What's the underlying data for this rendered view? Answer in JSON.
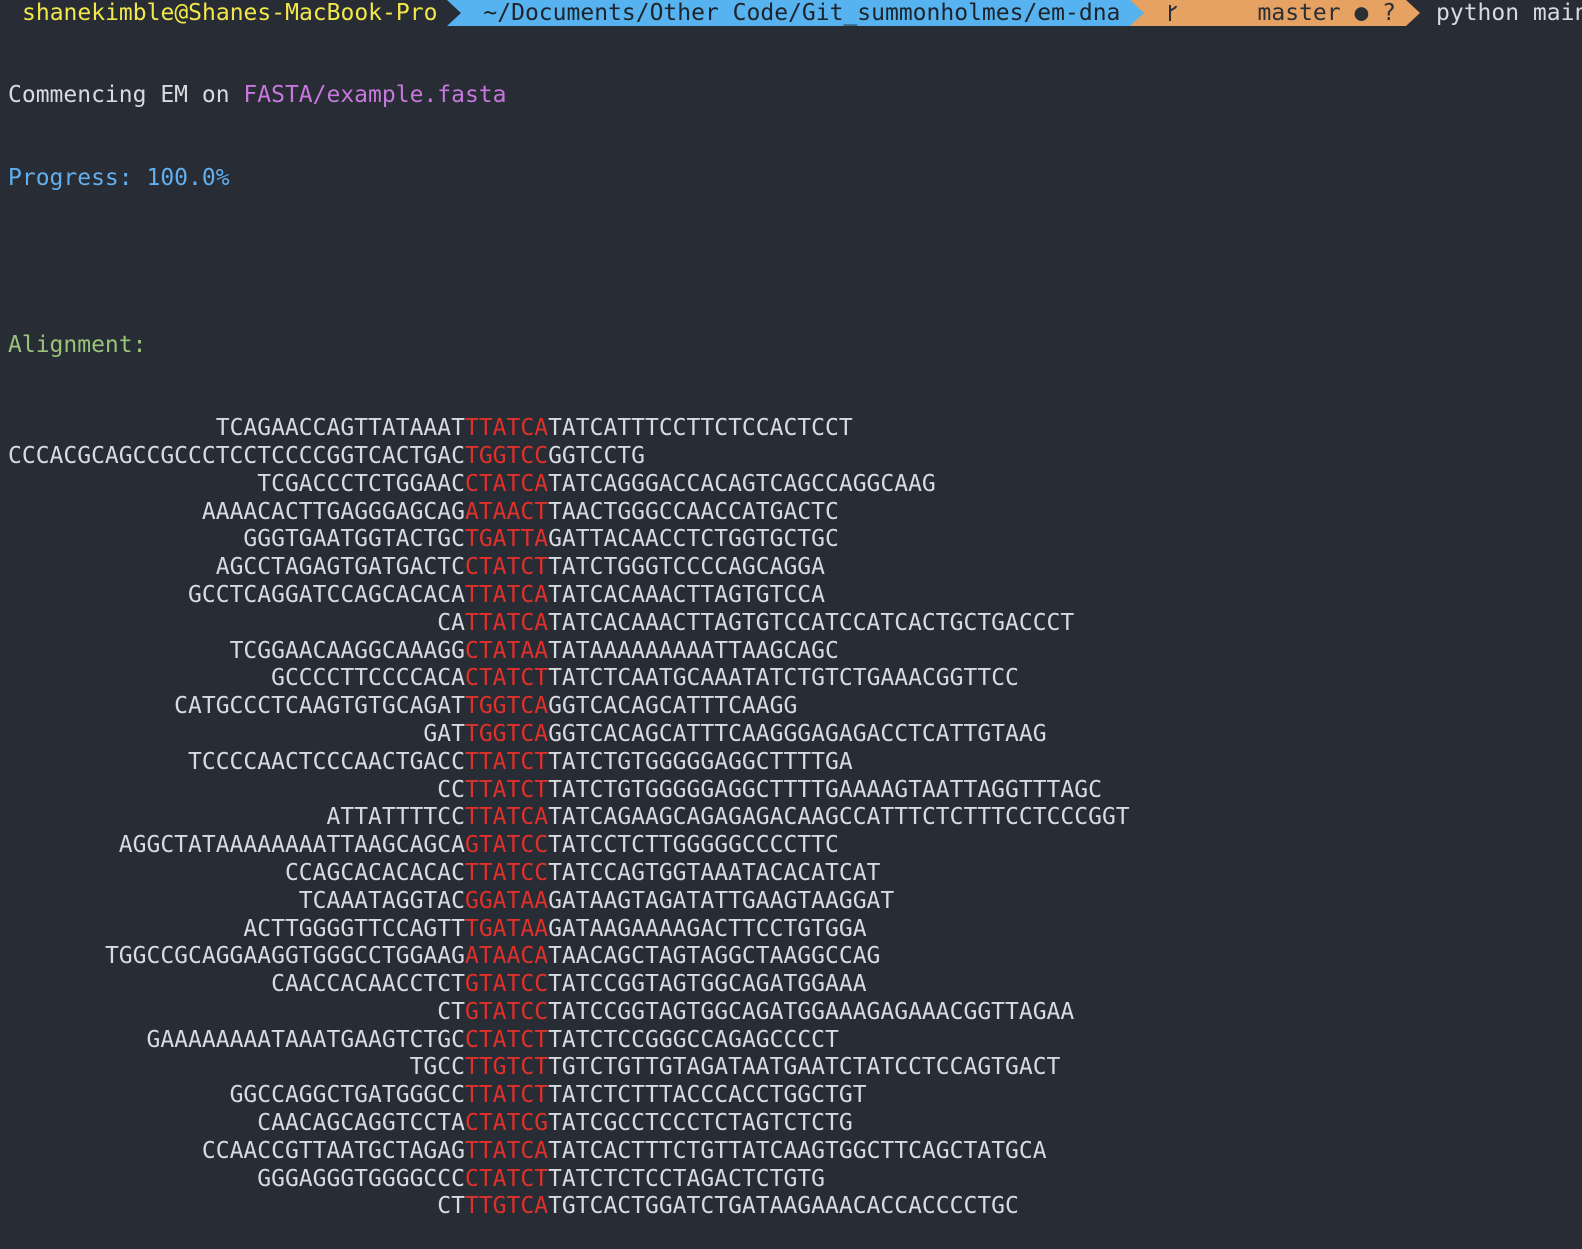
{
  "prompt": {
    "user_host": "shanekimble@Shanes-MacBook-Pro",
    "path": "~/Documents/Other Code/Git_summonholmes/em-dna",
    "branch_icon": "git-branch-icon",
    "branch": "master",
    "status": "● ?",
    "command": "python main.py"
  },
  "output": {
    "commencing_label": "Commencing EM on ",
    "fasta_path": "FASTA/example.fasta",
    "progress_label": "Progress: ",
    "progress_value": "100.0%",
    "alignment_label": "Alignment:"
  },
  "colors": {
    "background": "#282c34",
    "motif": "#e0302a",
    "path_segment": "#56b3f0",
    "git_segment": "#e5a263",
    "user_text": "#f2e74b"
  },
  "alignment": [
    {
      "indent": "               ",
      "prefix": "TCAGAACCAGTTATAAAT",
      "motif": "TTATCA",
      "suffix": "TATCATTTCCTTCTCCACTCCT"
    },
    {
      "indent": "",
      "prefix": "CCCACGCAGCCGCCCTCCTCCCCGGTCACTGAC",
      "motif": "TGGTCC",
      "suffix": "GGTCCTG"
    },
    {
      "indent": "                  ",
      "prefix": "TCGACCCTCTGGAAC",
      "motif": "CTATCA",
      "suffix": "TATCAGGGACCACAGTCAGCCAGGCAAG"
    },
    {
      "indent": "              ",
      "prefix": "AAAACACTTGAGGGAGCAG",
      "motif": "ATAACT",
      "suffix": "TAACTGGGCCAACCATGACTC"
    },
    {
      "indent": "                 ",
      "prefix": "GGGTGAATGGTACTGC",
      "motif": "TGATTA",
      "suffix": "GATTACAACCTCTGGTGCTGC"
    },
    {
      "indent": "               ",
      "prefix": "AGCCTAGAGTGATGACTC",
      "motif": "CTATCT",
      "suffix": "TATCTGGGTCCCCAGCAGGA"
    },
    {
      "indent": "             ",
      "prefix": "GCCTCAGGATCCAGCACACA",
      "motif": "TTATCA",
      "suffix": "TATCACAAACTTAGTGTCCA"
    },
    {
      "indent": "                               ",
      "prefix": "CA",
      "motif": "TTATCA",
      "suffix": "TATCACAAACTTAGTGTCCATCCATCACTGCTGACCCT"
    },
    {
      "indent": "                ",
      "prefix": "TCGGAACAAGGCAAAGG",
      "motif": "CTATAA",
      "suffix": "TATAAAAAAAAATTAAGCAGC"
    },
    {
      "indent": "                   ",
      "prefix": "GCCCCTTCCCCACA",
      "motif": "CTATCT",
      "suffix": "TATCTCAATGCAAATATCTGTCTGAAACGGTTCC"
    },
    {
      "indent": "            ",
      "prefix": "CATGCCCTCAAGTGTGCAGAT",
      "motif": "TGGTCA",
      "suffix": "GGTCACAGCATTTCAAGG"
    },
    {
      "indent": "                              ",
      "prefix": "GAT",
      "motif": "TGGTCA",
      "suffix": "GGTCACAGCATTTCAAGGGAGAGACCTCATTGTAAG"
    },
    {
      "indent": "             ",
      "prefix": "TCCCCAACTCCCAACTGACC",
      "motif": "TTATCT",
      "suffix": "TATCTGTGGGGGAGGCTTTTGA"
    },
    {
      "indent": "                               ",
      "prefix": "CC",
      "motif": "TTATCT",
      "suffix": "TATCTGTGGGGGAGGCTTTTGAAAAGTAATTAGGTTTAGC"
    },
    {
      "indent": "                       ",
      "prefix": "ATTATTTTCC",
      "motif": "TTATCA",
      "suffix": "TATCAGAAGCAGAGAGACAAGCCATTTCTCTTTCCTCCCGGT"
    },
    {
      "indent": "        ",
      "prefix": "AGGCTATAAAAAAAATTAAGCAGCA",
      "motif": "GTATCC",
      "suffix": "TATCCTCTTGGGGGCCCCTTC"
    },
    {
      "indent": "                    ",
      "prefix": "CCAGCACACACAC",
      "motif": "TTATCC",
      "suffix": "TATCCAGTGGTAAATACACATCAT"
    },
    {
      "indent": "                     ",
      "prefix": "TCAAATAGGTAC",
      "motif": "GGATAA",
      "suffix": "GATAAGTAGATATTGAAGTAAGGAT"
    },
    {
      "indent": "                 ",
      "prefix": "ACTTGGGGTTCCAGTT",
      "motif": "TGATAA",
      "suffix": "GATAAGAAAAGACTTCCTGTGGA"
    },
    {
      "indent": "       ",
      "prefix": "TGGCCGCAGGAAGGTGGGCCTGGAAG",
      "motif": "ATAACA",
      "suffix": "TAACAGCTAGTAGGCTAAGGCCAG"
    },
    {
      "indent": "                   ",
      "prefix": "CAACCACAACCTCT",
      "motif": "GTATCC",
      "suffix": "TATCCGGTAGTGGCAGATGGAAA"
    },
    {
      "indent": "                               ",
      "prefix": "CT",
      "motif": "GTATCC",
      "suffix": "TATCCGGTAGTGGCAGATGGAAAGAGAAACGGTTAGAA"
    },
    {
      "indent": "          ",
      "prefix": "GAAAAAAAATAAATGAAGTCTGC",
      "motif": "CTATCT",
      "suffix": "TATCTCCGGGCCAGAGCCCCT"
    },
    {
      "indent": "                             ",
      "prefix": "TGCC",
      "motif": "TTGTCT",
      "suffix": "TGTCTGTTGTAGATAATGAATCTATCCTCCAGTGACT"
    },
    {
      "indent": "                ",
      "prefix": "GGCCAGGCTGATGGGCC",
      "motif": "TTATCT",
      "suffix": "TATCTCTTTACCCACCTGGCTGT"
    },
    {
      "indent": "                  ",
      "prefix": "CAACAGCAGGTCCTA",
      "motif": "CTATCG",
      "suffix": "TATCGCCTCCCTCTAGTCTCTG"
    },
    {
      "indent": "              ",
      "prefix": "CCAACCGTTAATGCTAGAG",
      "motif": "TTATCA",
      "suffix": "TATCACTTTCTGTTATCAAGTGGCTTCAGCTATGCA"
    },
    {
      "indent": "                  ",
      "prefix": "GGGAGGGTGGGGCCC",
      "motif": "CTATCT",
      "suffix": "TATCTCTCCTAGACTCTGTG"
    },
    {
      "indent": "                               ",
      "prefix": "CT",
      "motif": "TTGTCA",
      "suffix": "TGTCACTGGATCTGATAAGAAACACCACCCCTGC"
    }
  ]
}
